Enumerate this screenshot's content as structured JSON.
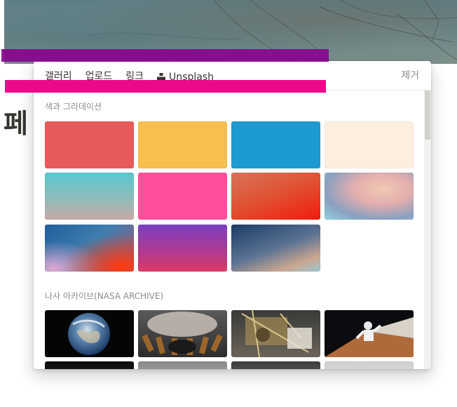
{
  "page": {
    "title": "페"
  },
  "popup": {
    "tabs": [
      {
        "label": "갤러리",
        "active": true
      },
      {
        "label": "업로드",
        "active": false
      },
      {
        "label": "링크",
        "active": false
      },
      {
        "label": "Unsplash",
        "active": false,
        "icon": "unsplash-icon"
      }
    ],
    "remove_label": "제거",
    "sections": {
      "colors": {
        "label": "색과 그라데이션",
        "tiles": [
          {
            "name": "red",
            "color": "#e85a5a"
          },
          {
            "name": "yellow",
            "color": "#f8be4e"
          },
          {
            "name": "blue",
            "color": "#1e9ad2"
          },
          {
            "name": "cream",
            "color": "#fdeee0"
          },
          {
            "name": "gradient-teal",
            "color": "#5ec9c9"
          },
          {
            "name": "pink",
            "color": "#ff4f9a"
          },
          {
            "name": "gradient-orange-red",
            "color": "#e84e32"
          },
          {
            "name": "gradient-blue-peach",
            "color": "#e7b8a8"
          },
          {
            "name": "gradient-blue-red",
            "color": "#2b6fae"
          },
          {
            "name": "gradient-purple-pink",
            "color": "#8c3fb0"
          },
          {
            "name": "gradient-navy-peach",
            "color": "#27456b"
          }
        ]
      },
      "nasa": {
        "label": "나사 아카이브(NASA ARCHIVE)",
        "tiles": [
          {
            "name": "earth"
          },
          {
            "name": "rocket-engine"
          },
          {
            "name": "lunar-module"
          },
          {
            "name": "spacewalk"
          },
          {
            "name": "space-station"
          },
          {
            "name": "moon-surface"
          },
          {
            "name": "astronaut"
          },
          {
            "name": "launch-pad"
          }
        ]
      }
    }
  }
}
